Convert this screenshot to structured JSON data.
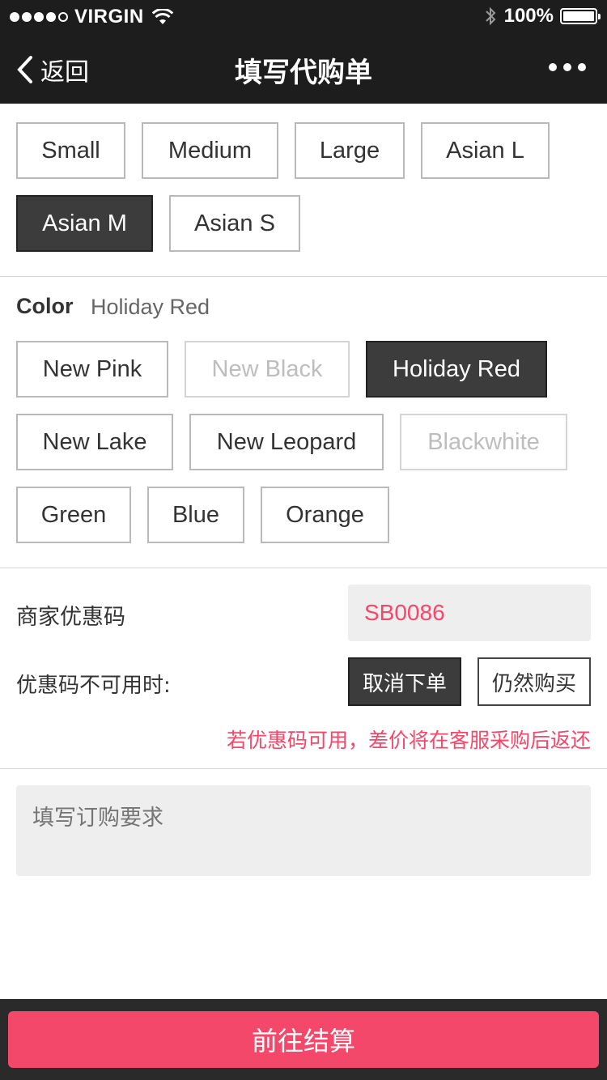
{
  "status": {
    "carrier": "VIRGIN",
    "battery": "100%"
  },
  "nav": {
    "back_label": "返回",
    "title": "填写代购单"
  },
  "sizes": [
    "Small",
    "Medium",
    "Large",
    "Asian L",
    "Asian M",
    "Asian S"
  ],
  "selected_size": "Asian M",
  "color": {
    "label": "Color",
    "selected": "Holiday Red",
    "options": [
      "New Pink",
      "New Black",
      "Holiday Red",
      "New Lake",
      "New Leopard",
      "Blackwhite",
      "Green",
      "Blue",
      "Orange"
    ],
    "unavailable": [
      "New Black",
      "Blackwhite"
    ]
  },
  "coupon": {
    "label": "商家优惠码",
    "value": "SB0086",
    "unavailable_label": "优惠码不可用时:",
    "cancel_label": "取消下单",
    "continue_label": "仍然购买",
    "notice": "若优惠码可用，差价将在客服采购后返还"
  },
  "request": {
    "placeholder": "填写订购要求"
  },
  "checkout_label": "前往结算",
  "colors": {
    "accent": "#f4486a",
    "nav_bg": "#1d1d1d",
    "selected_bg": "#3c3c3c"
  }
}
